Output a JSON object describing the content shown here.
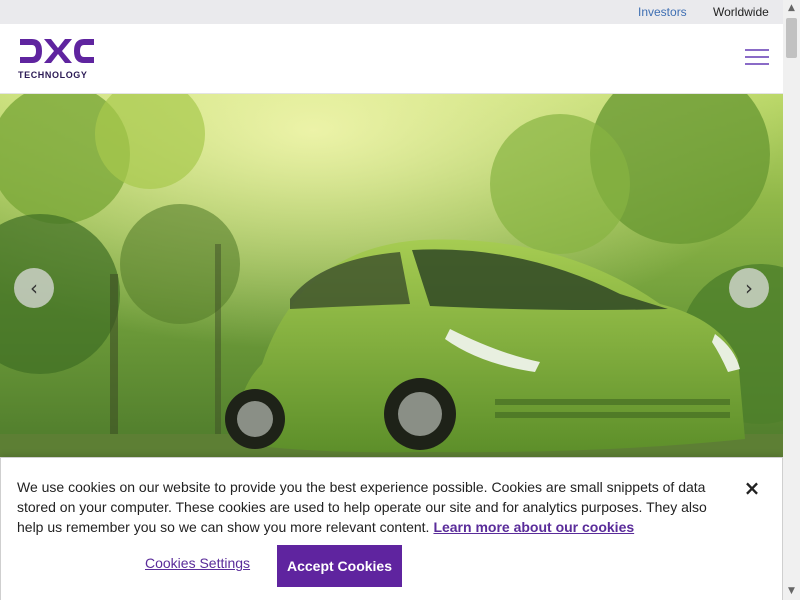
{
  "utility": {
    "investors": "Investors",
    "worldwide": "Worldwide"
  },
  "brand": {
    "logo_text": "DXC",
    "tagline": "TECHNOLOGY",
    "color": "#5f249f"
  },
  "hero": {
    "prev_arrow": "‹",
    "next_arrow": "›"
  },
  "cookie": {
    "message": "We use cookies on our website to provide you the best experience possible. Cookies are small snippets of data stored on your computer. These cookies are used to help operate our site and for analytics purposes. They also help us remember you so we can show you more relevant content.",
    "learn_more": "Learn more about our cookies",
    "close": "×",
    "settings_label": "Cookies Settings",
    "accept_label": "Accept Cookies"
  },
  "scrollbar": {
    "up": "▲",
    "down": "▼"
  }
}
